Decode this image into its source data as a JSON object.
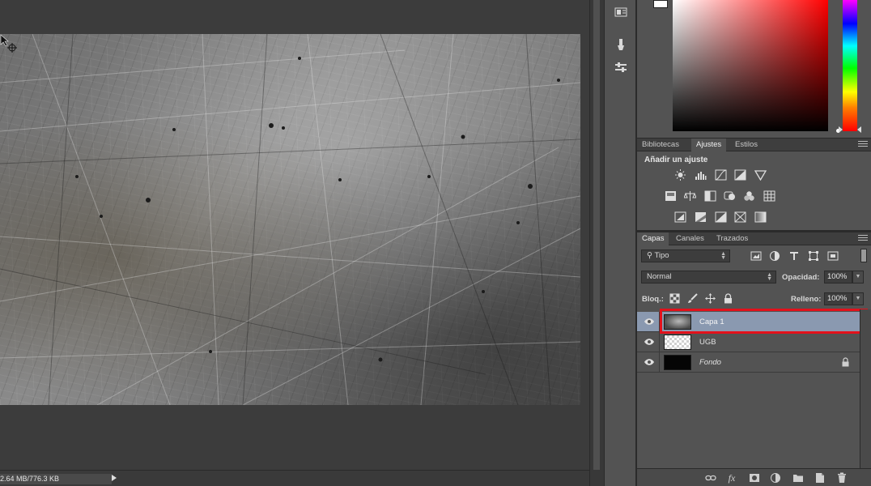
{
  "status": {
    "doc_size": "2.64 MB/776.3 KB"
  },
  "dock": {
    "icons": [
      "properties-icon",
      "brush-presets-icon",
      "adjust-sliders-icon"
    ]
  },
  "color_panel": {
    "foreground_color": "#ffffff",
    "selected_hue": "#ff0000"
  },
  "adjustments_panel": {
    "tabs": [
      "Bibliotecas",
      "Ajustes",
      "Estilos"
    ],
    "active_tab": "Ajustes",
    "title": "Añadir un ajuste"
  },
  "layers_panel": {
    "tabs": [
      "Capas",
      "Canales",
      "Trazados"
    ],
    "active_tab": "Capas",
    "filter_kind": "Tipo",
    "blend_mode": "Normal",
    "opacity_label": "Opacidad:",
    "opacity_value": "100%",
    "lock_label": "Bloq.:",
    "fill_label": "Relleno:",
    "fill_value": "100%",
    "layers": [
      {
        "name": "Capa 1",
        "selected": true,
        "visible": true,
        "thumb": "texture",
        "locked": false,
        "italic": false
      },
      {
        "name": "UGB",
        "selected": false,
        "visible": true,
        "thumb": "transparent",
        "locked": false,
        "italic": false
      },
      {
        "name": "Fondo",
        "selected": false,
        "visible": true,
        "thumb": "black",
        "locked": true,
        "italic": true
      }
    ],
    "highlight_color": "#e3111b",
    "selection_color": "#8a99b0"
  },
  "footer": {
    "fx_label": "fx"
  }
}
